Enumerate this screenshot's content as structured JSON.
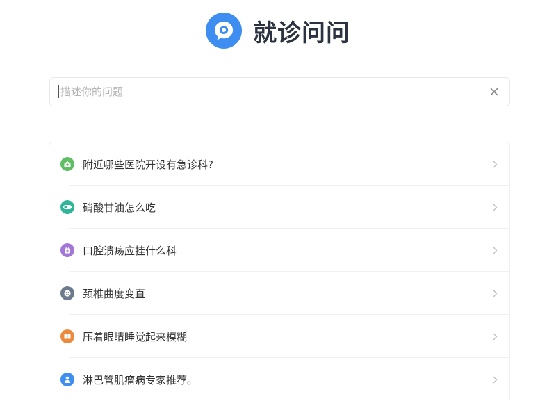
{
  "header": {
    "logo_icon": "chat-bubble-icon",
    "title": "就诊问问",
    "brand_color": "#3d8ef0"
  },
  "search": {
    "value": "",
    "placeholder": "描述你的问题",
    "clear_icon": "close-icon"
  },
  "suggestions": [
    {
      "label": "附近哪些医院开设有急诊科?",
      "icon": "hospital-icon",
      "color": "#5fbd62"
    },
    {
      "label": "硝酸甘油怎么吃",
      "icon": "pill-icon",
      "color": "#2fb59a"
    },
    {
      "label": "口腔溃疡应挂什么科",
      "icon": "medical-kit-icon",
      "color": "#a377d8"
    },
    {
      "label": "颈椎曲度变直",
      "icon": "face-icon",
      "color": "#6d7a8e"
    },
    {
      "label": "压着眼睛睡觉起来模糊",
      "icon": "book-icon",
      "color": "#ec8a3e"
    },
    {
      "label": "淋巴管肌瘤病专家推荐。",
      "icon": "doctor-icon",
      "color": "#3d8ef0"
    }
  ]
}
